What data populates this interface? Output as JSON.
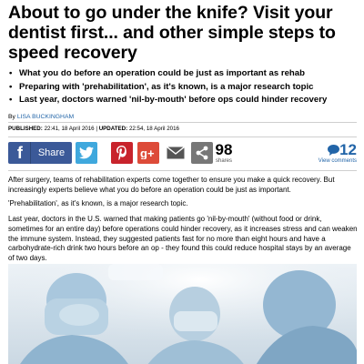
{
  "article": {
    "headline": "About to go under the knife? Visit your dentist first... and other simple steps to speed recovery",
    "bullets": [
      "What you do before an operation could be just as important as rehab",
      "Preparing with 'prehabilitation', as it's known, is a major research topic",
      "Last year, doctors warned 'nil-by-mouth' before ops could hinder recovery"
    ],
    "byline_prefix": "By",
    "author": "LISA BUCKINGHAM",
    "published_label": "PUBLISHED:",
    "published_value": "22:41, 18 April 2016",
    "separator": "|",
    "updated_label": "UPDATED:",
    "updated_value": "22:54, 18 April 2016",
    "paragraphs": [
      "After surgery, teams of rehabilitation experts come together to ensure you make a quick recovery. But increasingly experts believe what you do before an operation could be just as important.",
      "'Prehabilitation', as it's known, is a major research topic.",
      "Last year, doctors in the U.S. warned that making patients go 'nil-by-mouth' (without food or drink, sometimes for an entire day) before operations could hinder recovery, as it increases stress and can weaken the immune system. Instead, they suggested patients fast for no more than eight hours and have a carbohydrate-rich drink two hours before an op - they found this could reduce hospital stays by an average of two days."
    ]
  },
  "share": {
    "facebook_glyph": "f",
    "facebook_label": "Share",
    "count": "98",
    "count_label": "shares",
    "comments_count": "12",
    "comments_label": "View comments",
    "icons": [
      "facebook-icon",
      "twitter-icon",
      "pinterest-icon",
      "google-plus-icon",
      "email-icon",
      "share-icon",
      "comment-icon"
    ],
    "colors": {
      "facebook": "#3b5998",
      "twitter": "#3fa8dd",
      "pinterest": "#c8232c",
      "google_plus": "#dd4b39",
      "link": "#2265a8"
    }
  }
}
